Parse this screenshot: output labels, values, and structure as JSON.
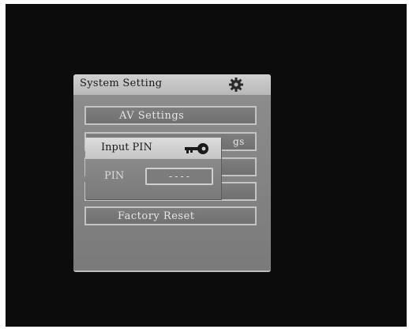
{
  "menu": {
    "title": "System Setting",
    "icon": "gear-icon",
    "items": [
      {
        "label": "AV Settings"
      },
      {
        "label": ""
      },
      {
        "label": ""
      },
      {
        "label": ""
      },
      {
        "label": "Factory Reset"
      }
    ],
    "partial_hint": "gs"
  },
  "pin_dialog": {
    "title": "Input PIN",
    "icon": "key-icon",
    "field_label": "PIN",
    "field_value": "----"
  },
  "colors": {
    "screen_bg": "#0c0c0c",
    "header_bg": "#c8c8c8",
    "panel_bg": "#848484",
    "item_border": "#c4c4c4",
    "text_light": "#e6e6e6"
  }
}
